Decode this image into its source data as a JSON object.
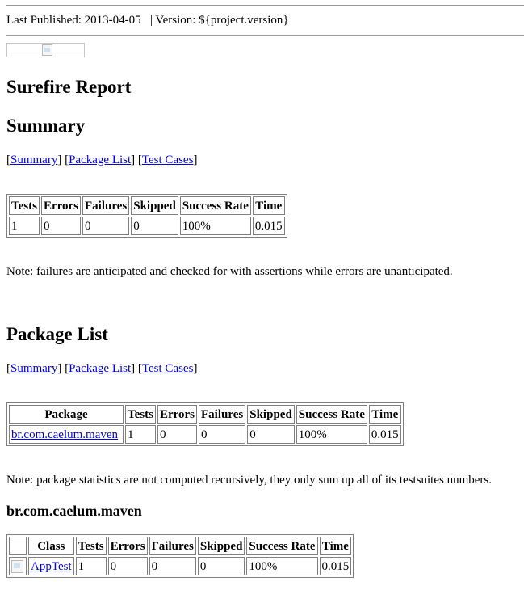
{
  "header": {
    "last_published": "Last Published: 2013-04-05",
    "separator": "|",
    "version": "Version: ${project.version}"
  },
  "title": "Surefire Report",
  "summary": {
    "heading": "Summary",
    "nav": [
      "Summary",
      "Package List",
      "Test Cases"
    ],
    "columns": [
      "Tests",
      "Errors",
      "Failures",
      "Skipped",
      "Success Rate",
      "Time"
    ],
    "row": [
      "1",
      "0",
      "0",
      "0",
      "100%",
      "0.015"
    ],
    "note": "Note: failures are anticipated and checked for with assertions while errors are unanticipated."
  },
  "package_list": {
    "heading": "Package List",
    "nav": [
      "Summary",
      "Package List",
      "Test Cases"
    ],
    "columns": [
      "Package",
      "Tests",
      "Errors",
      "Failures",
      "Skipped",
      "Success Rate",
      "Time"
    ],
    "row": [
      "br.com.caelum.maven",
      "1",
      "0",
      "0",
      "0",
      "100%",
      "0.015"
    ],
    "note": "Note: package statistics are not computed recursively, they only sum up all of its testsuites numbers."
  },
  "package_detail": {
    "heading": "br.com.caelum.maven",
    "columns": [
      "",
      "Class",
      "Tests",
      "Errors",
      "Failures",
      "Skipped",
      "Success Rate",
      "Time"
    ],
    "row": [
      "",
      "AppTest",
      "1",
      "0",
      "0",
      "0",
      "100%",
      "0.015"
    ]
  }
}
